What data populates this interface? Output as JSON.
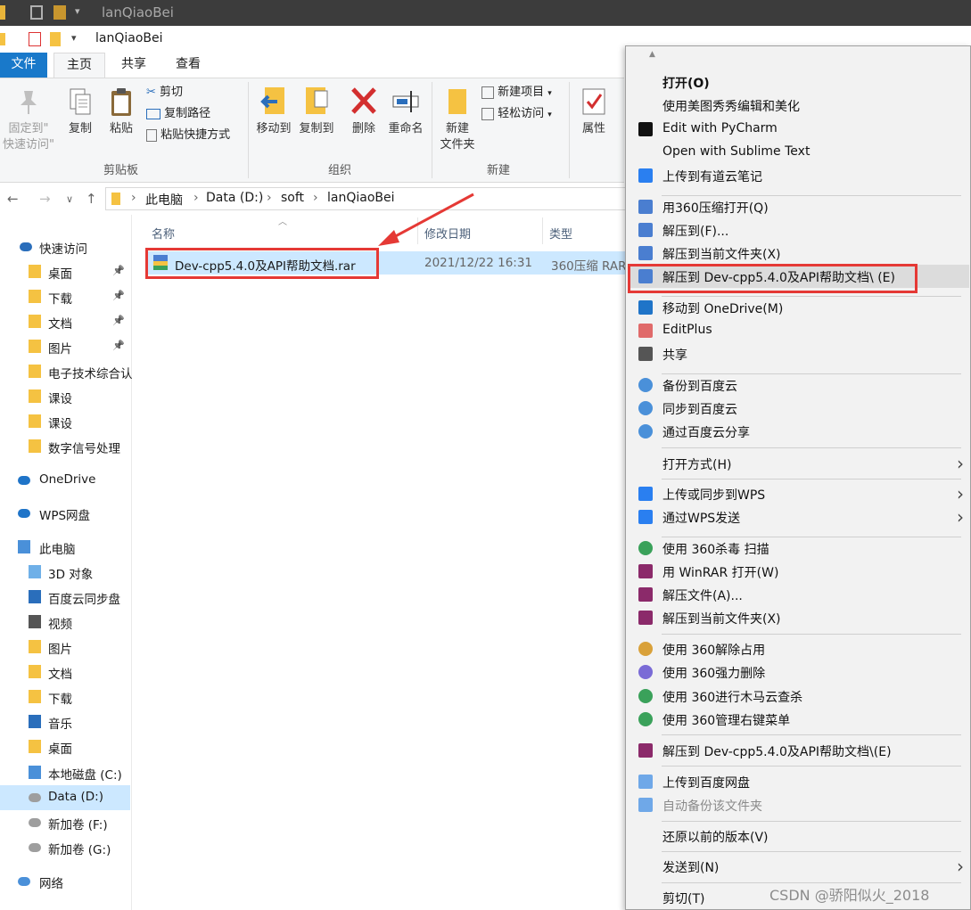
{
  "window": {
    "title": "lanQiaoBei"
  },
  "ribbon": {
    "tabs": [
      "文件",
      "主页",
      "共享",
      "查看"
    ],
    "clipboard": {
      "pin": "固定到\"\n快速访问\"",
      "copy": "复制",
      "paste": "粘贴",
      "cut": "剪切",
      "copy_path": "复制路径",
      "paste_shortcut": "粘贴快捷方式",
      "group": "剪贴板"
    },
    "organize": {
      "move_to": "移动到",
      "copy_to": "复制到",
      "delete": "删除",
      "rename": "重命名",
      "group": "组织"
    },
    "new": {
      "new_folder": "新建\n文件夹",
      "new_item": "新建项目",
      "easy_access": "轻松访问",
      "group": "新建"
    },
    "open": {
      "properties": "属性"
    }
  },
  "address": {
    "path": [
      "此电脑",
      "Data (D:)",
      "soft",
      "lanQiaoBei"
    ]
  },
  "nav": {
    "items": [
      {
        "label": "快速访问",
        "icon": "star-icon"
      },
      {
        "label": "桌面",
        "icon": "desktop-folder-icon",
        "pinned": true
      },
      {
        "label": "下载",
        "icon": "download-folder-icon",
        "pinned": true
      },
      {
        "label": "文档",
        "icon": "documents-folder-icon",
        "pinned": true
      },
      {
        "label": "图片",
        "icon": "pictures-folder-icon",
        "pinned": true
      },
      {
        "label": "电子技术综合认",
        "icon": "folder-icon"
      },
      {
        "label": "课设",
        "icon": "folder-icon"
      },
      {
        "label": "课设",
        "icon": "folder-icon"
      },
      {
        "label": "数字信号处理",
        "icon": "folder-icon"
      },
      {
        "label": "OneDrive",
        "icon": "onedrive-icon"
      },
      {
        "label": "WPS网盘",
        "icon": "wps-cloud-icon"
      },
      {
        "label": "此电脑",
        "icon": "computer-icon"
      },
      {
        "label": "3D 对象",
        "icon": "3d-objects-icon"
      },
      {
        "label": "百度云同步盘",
        "icon": "baidu-cloud-icon"
      },
      {
        "label": "视频",
        "icon": "videos-folder-icon"
      },
      {
        "label": "图片",
        "icon": "pictures-folder-icon"
      },
      {
        "label": "文档",
        "icon": "documents-folder-icon"
      },
      {
        "label": "下载",
        "icon": "download-folder-icon"
      },
      {
        "label": "音乐",
        "icon": "music-folder-icon"
      },
      {
        "label": "桌面",
        "icon": "desktop-folder-icon"
      },
      {
        "label": "本地磁盘 (C:)",
        "icon": "windows-drive-icon"
      },
      {
        "label": "Data (D:)",
        "icon": "drive-icon",
        "selected": true
      },
      {
        "label": "新加卷 (F:)",
        "icon": "drive-icon"
      },
      {
        "label": "新加卷 (G:)",
        "icon": "drive-icon"
      },
      {
        "label": "网络",
        "icon": "network-icon"
      }
    ]
  },
  "columns": {
    "name": "名称",
    "modified": "修改日期",
    "type": "类型"
  },
  "file": {
    "name": "Dev-cpp5.4.0及API帮助文档.rar",
    "modified": "2021/12/22 16:31",
    "type": "360压缩 RAR"
  },
  "context_menu": {
    "items": [
      {
        "label": "打开(O)",
        "bold": true
      },
      {
        "label": "使用美图秀秀编辑和美化"
      },
      {
        "label": "Edit with PyCharm",
        "icon": "pycharm-icon"
      },
      {
        "label": "Open with Sublime Text"
      },
      {
        "label": "上传到有道云笔记",
        "icon": "youdao-note-icon"
      },
      {
        "label": "用360压缩打开(Q)",
        "icon": "360zip-icon"
      },
      {
        "label": "解压到(F)...",
        "icon": "360zip-icon"
      },
      {
        "label": "解压到当前文件夹(X)",
        "icon": "360zip-icon"
      },
      {
        "label": "解压到 Dev-cpp5.4.0及API帮助文档\\ (E)",
        "icon": "360zip-icon",
        "highlighted": true
      },
      {
        "label": "移动到 OneDrive(M)",
        "icon": "onedrive-icon"
      },
      {
        "label": "EditPlus",
        "icon": "editplus-icon"
      },
      {
        "label": "共享",
        "icon": "share-icon"
      },
      {
        "label": "备份到百度云",
        "icon": "baidu-cloud-icon"
      },
      {
        "label": "同步到百度云",
        "icon": "baidu-cloud-icon"
      },
      {
        "label": "通过百度云分享",
        "icon": "baidu-cloud-icon"
      },
      {
        "label": "打开方式(H)",
        "submenu": true
      },
      {
        "label": "上传或同步到WPS",
        "icon": "wps-upload-icon",
        "submenu": true
      },
      {
        "label": "通过WPS发送",
        "icon": "wps-send-icon",
        "submenu": true
      },
      {
        "label": "使用 360杀毒 扫描",
        "icon": "360-antivirus-icon"
      },
      {
        "label": "用 WinRAR 打开(W)",
        "icon": "winrar-icon"
      },
      {
        "label": "解压文件(A)...",
        "icon": "winrar-icon"
      },
      {
        "label": "解压到当前文件夹(X)",
        "icon": "winrar-icon"
      },
      {
        "label": "使用 360解除占用",
        "icon": "360-unlock-icon"
      },
      {
        "label": "使用 360强力删除",
        "icon": "360-shred-icon"
      },
      {
        "label": "使用 360进行木马云查杀",
        "icon": "360-security-icon"
      },
      {
        "label": "使用 360管理右键菜单",
        "icon": "360-security-icon"
      },
      {
        "label": "解压到 Dev-cpp5.4.0及API帮助文档\\(E)",
        "icon": "winrar-icon"
      },
      {
        "label": "上传到百度网盘",
        "icon": "baidu-netdisk-icon"
      },
      {
        "label": "自动备份该文件夹",
        "icon": "baidu-netdisk-icon",
        "disabled": true
      },
      {
        "label": "还原以前的版本(V)"
      },
      {
        "label": "发送到(N)",
        "submenu": true
      },
      {
        "label": "剪切(T)"
      }
    ]
  },
  "watermark": "CSDN @骄阳似火_2018"
}
